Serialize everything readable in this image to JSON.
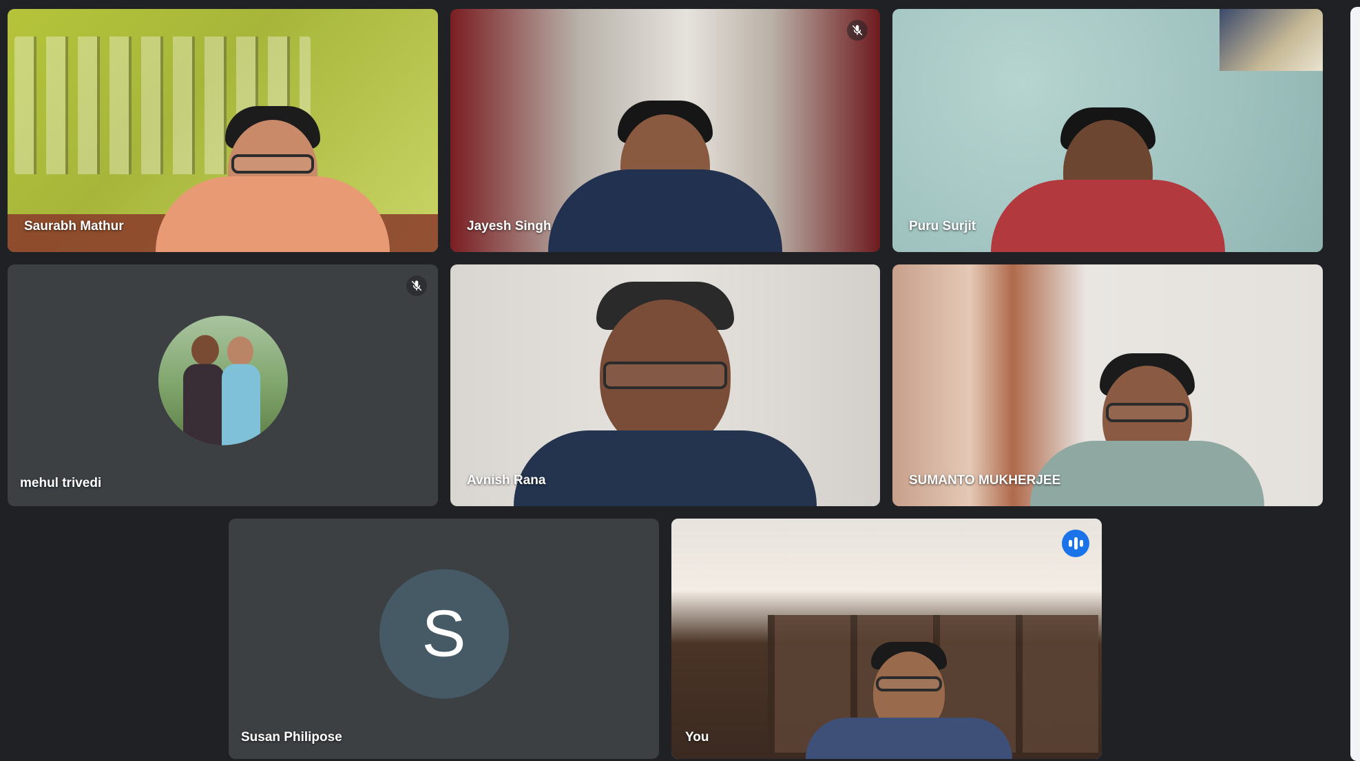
{
  "meeting": {
    "participants": [
      {
        "name": "Saurabh Mathur"
      },
      {
        "name": "Jayesh Singh",
        "muted": true
      },
      {
        "name": "Puru Surjit"
      },
      {
        "name": "mehul trivedi",
        "muted": true
      },
      {
        "name": "Avnish Rana"
      },
      {
        "name": "SUMANTO MUKHERJEE"
      },
      {
        "name": "Susan Philipose",
        "avatar_letter": "S"
      },
      {
        "name": "You",
        "speaking": true
      }
    ]
  },
  "icons": {
    "muted": "mic-off-icon",
    "speaking": "audio-level-icon"
  },
  "colors": {
    "background": "#202124",
    "tile": "#3c4043",
    "active_border": "#8ab4f8",
    "speaking_badge": "#1a73e8",
    "letter_avatar": "#455a64"
  }
}
